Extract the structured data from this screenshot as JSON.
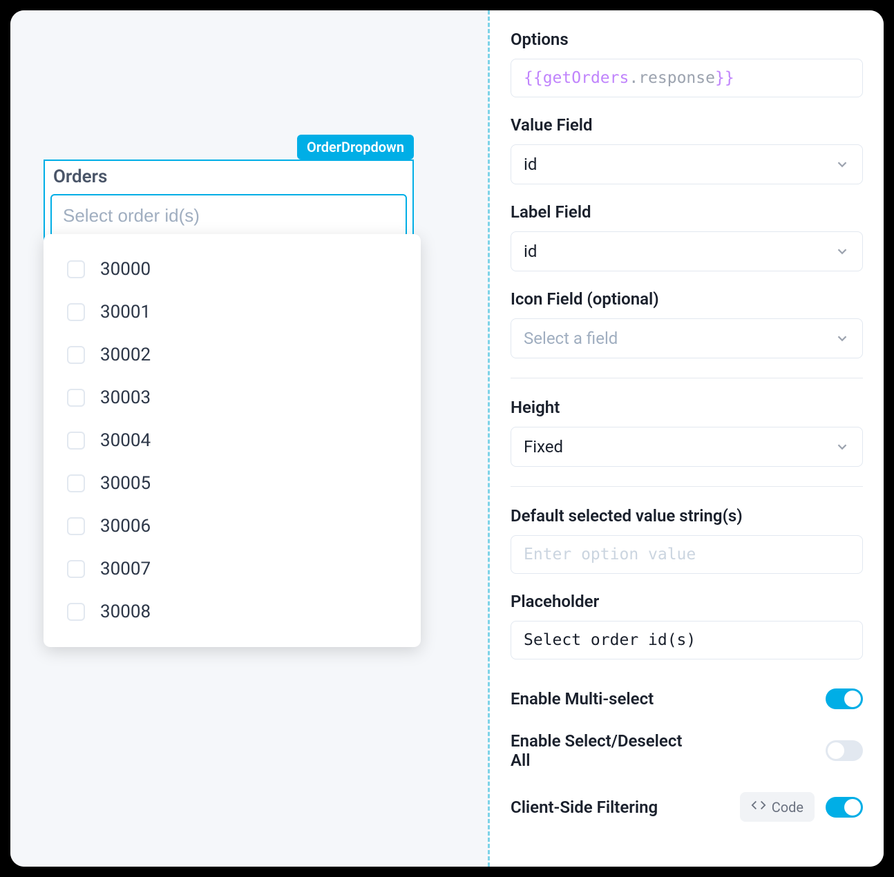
{
  "canvas": {
    "widget_tag": "OrderDropdown",
    "widget_label": "Orders",
    "widget_placeholder": "Select order id(s)",
    "options": [
      "30000",
      "30001",
      "30002",
      "30003",
      "30004",
      "30005",
      "30006",
      "30007",
      "30008"
    ]
  },
  "panel": {
    "options": {
      "label": "Options",
      "expression_braces_open": "{{",
      "expression_object": "getOrders",
      "expression_dot": ".",
      "expression_prop": "response",
      "expression_braces_close": "}}"
    },
    "value_field": {
      "label": "Value Field",
      "value": "id"
    },
    "label_field": {
      "label": "Label Field",
      "value": "id"
    },
    "icon_field": {
      "label": "Icon Field (optional)",
      "placeholder": "Select a field"
    },
    "height": {
      "label": "Height",
      "value": "Fixed"
    },
    "default_selected": {
      "label": "Default selected value string(s)",
      "placeholder": "Enter option value"
    },
    "placeholder_field": {
      "label": "Placeholder",
      "value": "Select order id(s)"
    },
    "multi_select": {
      "label": "Enable Multi-select",
      "on": true
    },
    "select_all": {
      "label": "Enable Select/Deselect All",
      "on": false
    },
    "client_filter": {
      "label": "Client-Side Filtering",
      "code_label": "Code",
      "on": true
    }
  }
}
